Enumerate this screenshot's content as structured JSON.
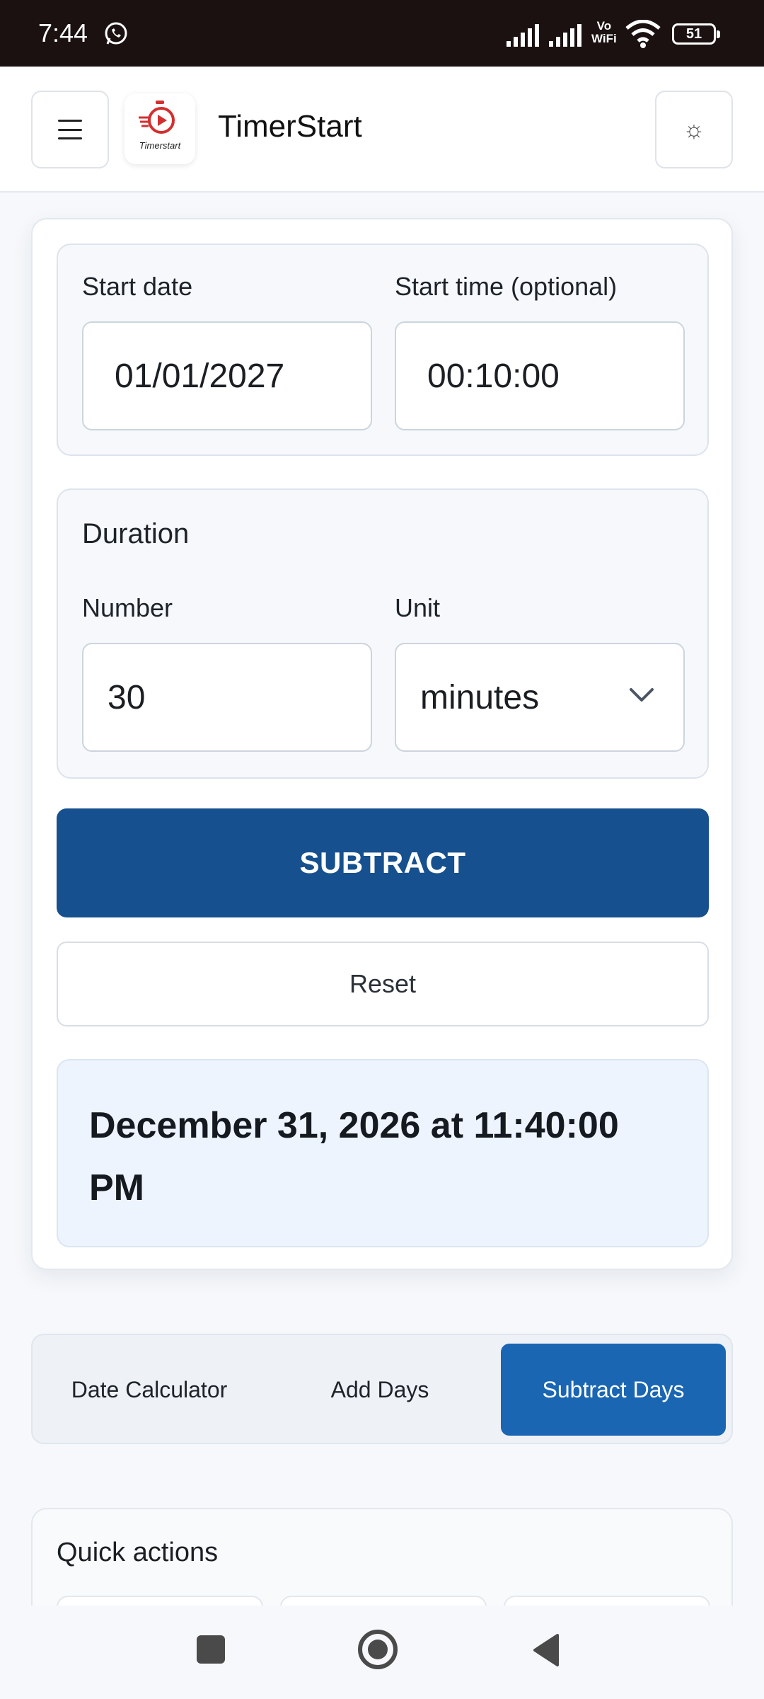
{
  "status_bar": {
    "time": "7:44",
    "vowifi_top": "Vo",
    "vowifi_bottom": "WiFi",
    "battery": "51",
    "icons": [
      "whatsapp-icon",
      "signal-icon",
      "signal-icon",
      "vowifi-icon",
      "wifi-icon",
      "battery-icon"
    ]
  },
  "header": {
    "title": "TimerStart",
    "logo_text": "Timerstart",
    "menu_icon": "hamburger-menu-icon",
    "theme_icon": "sun-icon",
    "theme_glyph": "☼"
  },
  "start": {
    "date_label": "Start date",
    "date_value": "01/01/2027",
    "time_label": "Start time (optional)",
    "time_value": "00:10:00"
  },
  "duration": {
    "heading": "Duration",
    "number_label": "Number",
    "number_value": "30",
    "unit_label": "Unit",
    "unit_value": "minutes"
  },
  "actions": {
    "subtract": "SUBTRACT",
    "reset": "Reset"
  },
  "result": {
    "text": "December 31, 2026 at 11:40:00 PM"
  },
  "tabs": [
    {
      "label": "Date Calculator",
      "active": false
    },
    {
      "label": "Add Days",
      "active": false
    },
    {
      "label": "Subtract Days",
      "active": true
    }
  ],
  "quick_actions": {
    "title": "Quick actions"
  },
  "colors": {
    "primary": "#17508e",
    "tab_active": "#1a66b2",
    "result_bg": "#edf4fe",
    "logo_red": "#d32f2f"
  },
  "nav": {
    "icons": [
      "recents-square-icon",
      "home-circle-icon",
      "back-triangle-icon"
    ]
  }
}
